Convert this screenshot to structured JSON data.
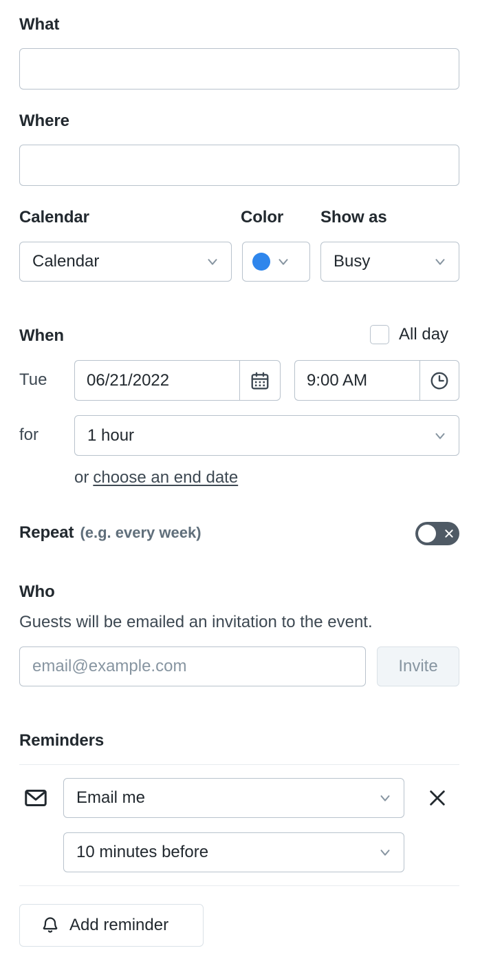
{
  "form": {
    "what": {
      "label": "What",
      "value": "",
      "placeholder": ""
    },
    "where": {
      "label": "Where",
      "value": "",
      "placeholder": ""
    },
    "calendar": {
      "label": "Calendar",
      "value": "Calendar"
    },
    "color": {
      "label": "Color",
      "value_hex": "#2f86ec"
    },
    "show_as": {
      "label": "Show as",
      "value": "Busy"
    },
    "when": {
      "label": "When",
      "all_day_label": "All day",
      "all_day_checked": false,
      "weekday": "Tue",
      "date": "06/21/2022",
      "time": "9:00 AM",
      "for_label": "for",
      "duration": "1 hour",
      "or_text": "or",
      "end_date_link": "choose an end date"
    },
    "repeat": {
      "label": "Repeat",
      "hint": "(e.g. every week)",
      "enabled": false,
      "toggle_glyph": "close-icon"
    },
    "who": {
      "label": "Who",
      "description": "Guests will be emailed an invitation to the event.",
      "email_value": "",
      "email_placeholder": "email@example.com",
      "invite_label": "Invite"
    },
    "reminders": {
      "label": "Reminders",
      "items": [
        {
          "channel_icon": "envelope-icon",
          "type": "Email me",
          "timing": "10 minutes before",
          "remove_label": "×"
        }
      ],
      "add_label": "Add reminder",
      "add_icon": "bell-icon"
    }
  },
  "colors": {
    "accent": "#2f86ec",
    "border": "#b8c2cc",
    "text": "#22292f",
    "muted_text": "#8795a1",
    "toggle_off_bg": "#4f5a65",
    "button_bg": "#f1f5f8"
  }
}
